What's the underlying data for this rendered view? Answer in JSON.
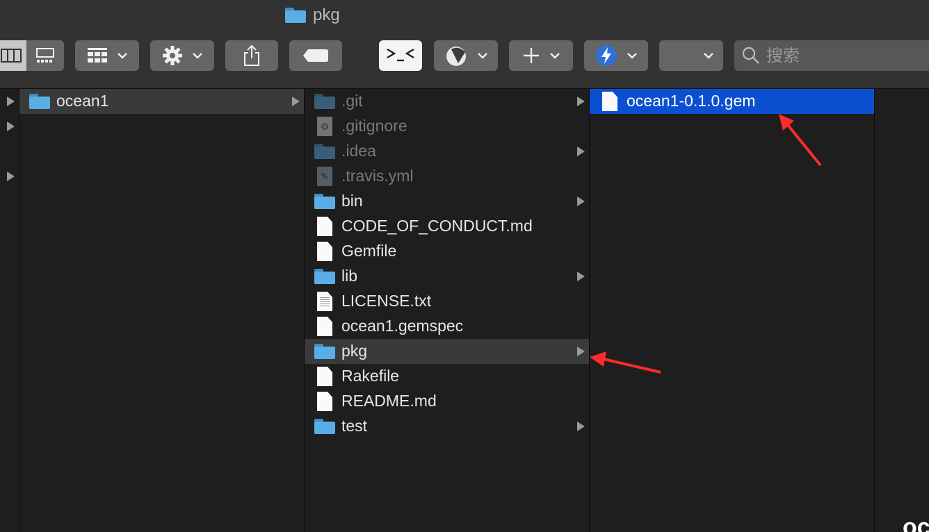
{
  "window": {
    "title": "pkg",
    "title_icon": "folder-icon"
  },
  "toolbar": {
    "view_modes": [
      "columns-view-icon",
      "gallery-view-icon"
    ],
    "group_icon": "group-grid-icon",
    "action_icon": "gear-icon",
    "share_icon": "share-icon",
    "tags_icon": "tag-icon",
    "terminal_icon": "terminal-icon",
    "app2_icon": "app-icon",
    "new_icon": "plus-icon",
    "app3_icon": "bolt-app-icon",
    "search_placeholder": "搜索"
  },
  "columns": {
    "col1": [
      {
        "name": "ocean1",
        "kind": "folder",
        "selected": "gray",
        "has_children": true
      }
    ],
    "col2": [
      {
        "name": ".git",
        "kind": "folder",
        "dim": true,
        "has_children": true
      },
      {
        "name": ".gitignore",
        "kind": "gear-doc",
        "dim": true
      },
      {
        "name": ".idea",
        "kind": "folder",
        "dim": true,
        "has_children": true
      },
      {
        "name": ".travis.yml",
        "kind": "script-doc",
        "dim": true
      },
      {
        "name": "bin",
        "kind": "folder",
        "has_children": true
      },
      {
        "name": "CODE_OF_CONDUCT.md",
        "kind": "doc"
      },
      {
        "name": "Gemfile",
        "kind": "doc"
      },
      {
        "name": "lib",
        "kind": "folder",
        "has_children": true
      },
      {
        "name": "LICENSE.txt",
        "kind": "txt-doc"
      },
      {
        "name": "ocean1.gemspec",
        "kind": "doc"
      },
      {
        "name": "pkg",
        "kind": "folder",
        "selected": "gray",
        "has_children": true
      },
      {
        "name": "Rakefile",
        "kind": "doc"
      },
      {
        "name": "README.md",
        "kind": "doc"
      },
      {
        "name": "test",
        "kind": "folder",
        "has_children": true
      }
    ],
    "col3": [
      {
        "name": "ocean1-0.1.0.gem",
        "kind": "doc",
        "selected": "blue"
      }
    ]
  },
  "annotations": {
    "color": "#ff2a2a",
    "count": 2
  },
  "corner_text": "oc"
}
